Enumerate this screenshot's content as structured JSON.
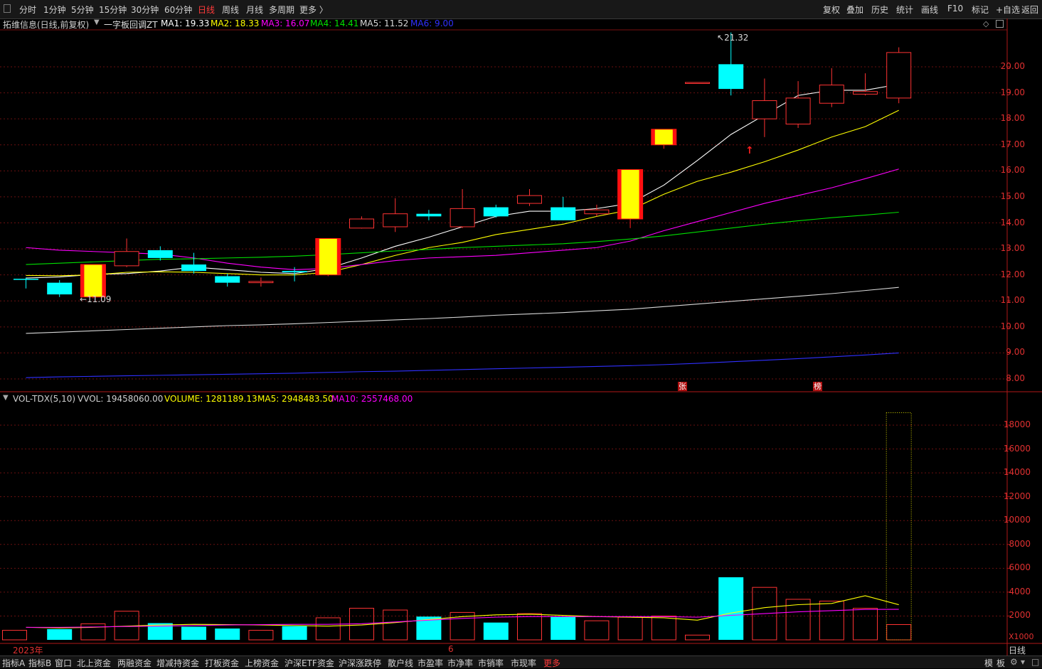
{
  "toolbar": {
    "periods": [
      "分时",
      "1分钟",
      "5分钟",
      "15分钟",
      "30分钟",
      "60分钟",
      "日线",
      "周线",
      "月线",
      "多周期",
      "更多 〉"
    ],
    "active": "日线",
    "right": [
      "复权",
      "叠加",
      "历史",
      "统计",
      "画线",
      "F10",
      "标记",
      "+自选",
      "返回"
    ]
  },
  "main_header": {
    "stock": "拓维信息(日线,前复权)",
    "indicator": "一字板回调ZT",
    "ma": [
      {
        "text": "MA1: 19.33",
        "color": "#ffffff"
      },
      {
        "text": "MA2: 18.33",
        "color": "#ffff00"
      },
      {
        "text": "MA3: 16.07",
        "color": "#ff00ff"
      },
      {
        "text": "MA4: 14.41",
        "color": "#00e000"
      },
      {
        "text": "MA5: 11.52",
        "color": "#d8d8d8"
      },
      {
        "text": "MA6: 9.00",
        "color": "#3030ff"
      }
    ]
  },
  "vol_header": {
    "name": "VOL-TDX(5,10)",
    "vvol": "VVOL: 19458060.00",
    "volume": "VOLUME: 1281189.13",
    "ma5": "MA5: 2948483.50",
    "ma10": "MA10: 2557468.00"
  },
  "price_axis": [
    "20.00",
    "19.00",
    "18.00",
    "17.00",
    "16.00",
    "15.00",
    "14.00",
    "13.00",
    "12.00",
    "11.00",
    "10.00",
    "9.00",
    "8.00"
  ],
  "volume_axis": [
    "18000",
    "16000",
    "14000",
    "12000",
    "10000",
    "8000",
    "6000",
    "4000",
    "2000"
  ],
  "volume_unit": "X1000",
  "annotations": {
    "high": "21.32",
    "low": "11.09",
    "zhang": "张",
    "bang": "榜"
  },
  "date_axis": {
    "year": "2023年",
    "month": "6"
  },
  "period_label": "日线",
  "bottom": {
    "tabs": [
      "指标A",
      "指标B",
      "窗口",
      "北上资金",
      "两融资金",
      "增减持资金",
      "打板资金",
      "上榜资金",
      "沪深ETF资金",
      "沪深涨跌停",
      "散户线",
      "市盈率",
      "市净率",
      "市销率",
      "市现率",
      "更多"
    ],
    "highlight": "更多",
    "right": [
      "模",
      "板"
    ]
  },
  "chart_data": {
    "type": "candlestick",
    "title": "拓维信息(日线,前复权)",
    "ylim": [
      7.8,
      21.9
    ],
    "volume_ylim": [
      0,
      19800
    ],
    "candles": [
      {
        "o": 11.85,
        "h": 11.9,
        "l": 11.48,
        "c": 11.85
      },
      {
        "o": 11.7,
        "h": 11.8,
        "l": 11.15,
        "c": 11.25
      },
      {
        "o": 11.15,
        "h": 12.4,
        "l": 11.09,
        "c": 12.4
      },
      {
        "o": 12.35,
        "h": 13.4,
        "l": 12.3,
        "c": 12.9
      },
      {
        "o": 12.95,
        "h": 13.1,
        "l": 12.55,
        "c": 12.65
      },
      {
        "o": 12.4,
        "h": 12.85,
        "l": 12.05,
        "c": 12.15
      },
      {
        "o": 11.95,
        "h": 12.05,
        "l": 11.55,
        "c": 11.7
      },
      {
        "o": 11.7,
        "h": 11.9,
        "l": 11.55,
        "c": 11.75
      },
      {
        "o": 12.15,
        "h": 12.3,
        "l": 11.75,
        "c": 12.1
      },
      {
        "o": 12.0,
        "h": 13.4,
        "l": 11.95,
        "c": 13.4
      },
      {
        "o": 13.8,
        "h": 14.25,
        "l": 13.78,
        "c": 14.15
      },
      {
        "o": 13.85,
        "h": 14.95,
        "l": 13.65,
        "c": 14.35
      },
      {
        "o": 14.35,
        "h": 14.5,
        "l": 14.1,
        "c": 14.25
      },
      {
        "o": 13.85,
        "h": 15.3,
        "l": 13.8,
        "c": 14.55
      },
      {
        "o": 14.6,
        "h": 14.7,
        "l": 14.2,
        "c": 14.25
      },
      {
        "o": 14.75,
        "h": 15.3,
        "l": 14.65,
        "c": 15.05
      },
      {
        "o": 14.6,
        "h": 15.0,
        "l": 14.1,
        "c": 14.1
      },
      {
        "o": 14.35,
        "h": 14.7,
        "l": 14.25,
        "c": 14.5
      },
      {
        "o": 14.15,
        "h": 16.05,
        "l": 13.8,
        "c": 16.05
      },
      {
        "o": 17.0,
        "h": 17.6,
        "l": 16.85,
        "c": 17.6
      },
      {
        "o": 19.4,
        "h": 19.4,
        "l": 19.4,
        "c": 19.4
      },
      {
        "o": 20.1,
        "h": 21.32,
        "l": 18.9,
        "c": 19.15
      },
      {
        "o": 18.0,
        "h": 19.55,
        "l": 17.3,
        "c": 18.7
      },
      {
        "o": 17.8,
        "h": 19.45,
        "l": 17.65,
        "c": 18.8
      },
      {
        "o": 18.6,
        "h": 19.95,
        "l": 18.45,
        "c": 19.3
      },
      {
        "o": 18.95,
        "h": 19.75,
        "l": 18.9,
        "c": 19.05
      },
      {
        "o": 18.8,
        "h": 20.75,
        "l": 18.6,
        "c": 20.55
      }
    ],
    "candle_style": [
      "down",
      "down",
      "special",
      "up",
      "down",
      "down",
      "down",
      "up",
      "down",
      "special",
      "up",
      "up",
      "down",
      "up",
      "down",
      "up",
      "down",
      "up",
      "special",
      "special",
      "up",
      "down",
      "up",
      "up",
      "up",
      "up",
      "up"
    ],
    "ma": [
      {
        "name": "MA1",
        "color": "#ffffff",
        "values": [
          11.88,
          11.92,
          12.02,
          12.05,
          12.15,
          12.3,
          12.2,
          12.1,
          12.05,
          12.25,
          12.65,
          13.1,
          13.45,
          13.85,
          14.25,
          14.45,
          14.45,
          14.55,
          14.75,
          15.45,
          16.4,
          17.4,
          18.15,
          18.9,
          19.1,
          19.1,
          19.33
        ]
      },
      {
        "name": "MA2",
        "color": "#ffff00",
        "values": [
          11.98,
          11.97,
          12.0,
          12.1,
          12.12,
          12.1,
          12.05,
          12.0,
          12.0,
          12.1,
          12.4,
          12.75,
          13.05,
          13.25,
          13.55,
          13.75,
          13.95,
          14.25,
          14.5,
          15.1,
          15.6,
          15.95,
          16.35,
          16.8,
          17.3,
          17.7,
          18.33
        ]
      },
      {
        "name": "MA3",
        "color": "#ff00ff",
        "values": [
          13.05,
          12.95,
          12.9,
          12.85,
          12.8,
          12.65,
          12.45,
          12.3,
          12.2,
          12.25,
          12.4,
          12.55,
          12.65,
          12.7,
          12.75,
          12.85,
          12.95,
          13.05,
          13.3,
          13.7,
          14.05,
          14.4,
          14.75,
          15.05,
          15.35,
          15.7,
          16.07
        ]
      },
      {
        "name": "MA4",
        "color": "#00e000",
        "values": [
          12.4,
          12.45,
          12.5,
          12.55,
          12.6,
          12.62,
          12.65,
          12.68,
          12.72,
          12.78,
          12.85,
          12.92,
          12.98,
          13.05,
          13.1,
          13.15,
          13.2,
          13.28,
          13.38,
          13.5,
          13.65,
          13.8,
          13.95,
          14.08,
          14.2,
          14.3,
          14.41
        ]
      },
      {
        "name": "MA5",
        "color": "#d8d8d8",
        "values": [
          9.75,
          9.8,
          9.85,
          9.9,
          9.95,
          10.0,
          10.05,
          10.08,
          10.12,
          10.17,
          10.22,
          10.27,
          10.32,
          10.38,
          10.45,
          10.5,
          10.55,
          10.62,
          10.68,
          10.78,
          10.88,
          10.98,
          11.08,
          11.18,
          11.28,
          11.4,
          11.52
        ]
      },
      {
        "name": "MA6",
        "color": "#3030ff",
        "values": [
          8.05,
          8.08,
          8.1,
          8.12,
          8.14,
          8.16,
          8.18,
          8.2,
          8.22,
          8.25,
          8.28,
          8.3,
          8.33,
          8.36,
          8.39,
          8.42,
          8.45,
          8.48,
          8.51,
          8.55,
          8.6,
          8.66,
          8.72,
          8.78,
          8.85,
          8.92,
          9.0
        ]
      }
    ],
    "volume": [
      800,
      900,
      1350,
      2400,
      1400,
      1100,
      950,
      800,
      1150,
      1850,
      2650,
      2500,
      1950,
      2300,
      1450,
      2200,
      1950,
      1600,
      1900,
      2000,
      400,
      5250,
      4400,
      3400,
      3250,
      2650,
      1281,
      19458
    ],
    "volume_style": [
      "up",
      "down",
      "up",
      "up",
      "down",
      "down",
      "down",
      "up",
      "down",
      "up",
      "up",
      "up",
      "down",
      "up",
      "down",
      "up",
      "down",
      "up",
      "up",
      "up",
      "up",
      "down",
      "up",
      "up",
      "up",
      "up",
      "up",
      "vvol"
    ],
    "volume_ma5": [
      1050,
      1000,
      1050,
      1150,
      1250,
      1300,
      1280,
      1250,
      1200,
      1150,
      1250,
      1450,
      1700,
      1950,
      2100,
      2150,
      2050,
      1950,
      1900,
      1850,
      1650,
      2250,
      2700,
      2950,
      3050,
      3700,
      2948
    ],
    "volume_ma10": [
      1050,
      1050,
      1080,
      1120,
      1150,
      1200,
      1250,
      1280,
      1300,
      1300,
      1350,
      1500,
      1650,
      1800,
      1900,
      1950,
      1950,
      1950,
      1950,
      1950,
      1900,
      2050,
      2200,
      2350,
      2450,
      2550,
      2557
    ]
  }
}
